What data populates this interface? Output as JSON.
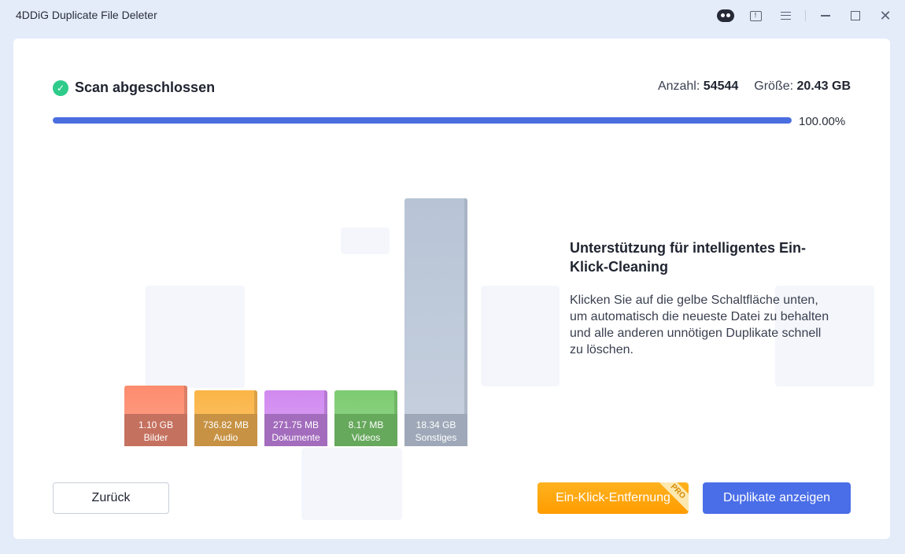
{
  "window": {
    "title": "4DDiG Duplicate File Deleter"
  },
  "scan": {
    "status": "Scan abgeschlossen",
    "count_label": "Anzahl:",
    "count_value": "54544",
    "size_label": "Größe:",
    "size_value": "20.43 GB",
    "progress_text": "100.00%",
    "progress_fraction": 1.0
  },
  "chart_data": {
    "type": "bar",
    "categories": [
      "Bilder",
      "Audio",
      "Dokumente",
      "Videos",
      "Sonstiges"
    ],
    "values_gb": [
      1.1,
      0.73682,
      0.27175,
      0.00817,
      18.34
    ],
    "labels": [
      "1.10 GB",
      "736.82 MB",
      "271.75 MB",
      "8.17 MB",
      "18.34 GB"
    ],
    "colors": [
      "#fd8c6e",
      "#fbb547",
      "#d18af0",
      "#7ccb70",
      "#b8c4d6"
    ],
    "label_colors": [
      "#c5715f",
      "#c79244",
      "#a36cbd",
      "#66a85c",
      "#9ea8b8"
    ]
  },
  "info": {
    "title": "Unterstützung für intelligentes Ein-Klick-Cleaning",
    "text": "Klicken Sie auf die gelbe Schaltfläche unten, um automatisch die neueste Datei zu behalten und alle anderen unnötigen Duplikate schnell zu löschen."
  },
  "buttons": {
    "back": "Zurück",
    "one_click": "Ein-Klick-Entfernung",
    "pro_badge": "PRO",
    "show_duplicates": "Duplikate anzeigen"
  },
  "titlebar_icons": [
    "robot-icon",
    "feedback-icon",
    "menu-icon",
    "minimize-icon",
    "maximize-icon",
    "close-icon"
  ]
}
